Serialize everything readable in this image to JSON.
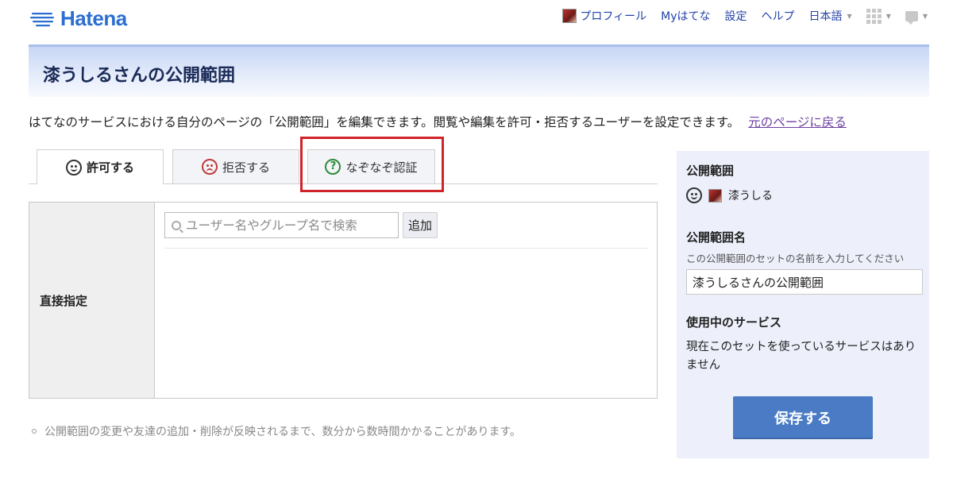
{
  "header": {
    "logo_text": "Hatena",
    "nav": {
      "profile": "プロフィール",
      "my": "Myはてな",
      "settings": "設定",
      "help": "ヘルプ",
      "language": "日本語"
    }
  },
  "page": {
    "title": "漆うしるさんの公開範囲",
    "description": "はてなのサービスにおける自分のページの「公開範囲」を編集できます。閲覧や編集を許可・拒否するユーザーを設定できます。",
    "back_link": "元のページに戻る"
  },
  "tabs": [
    {
      "label": "許可する",
      "icon": "smile-face-icon"
    },
    {
      "label": "拒否する",
      "icon": "angry-face-icon"
    },
    {
      "label": "なぞなぞ認証",
      "icon": "question-icon"
    }
  ],
  "direct": {
    "row_label": "直接指定",
    "search_placeholder": "ユーザー名やグループ名で検索",
    "add_label": "追加"
  },
  "note": "公開範囲の変更や友達の追加・削除が反映されるまで、数分から数時間かかることがあります。",
  "side": {
    "scope_heading": "公開範囲",
    "scope_user": "漆うしる",
    "name_heading": "公開範囲名",
    "name_hint": "この公開範囲のセットの名前を入力してください",
    "name_value": "漆うしるさんの公開範囲",
    "service_heading": "使用中のサービス",
    "service_text": "現在このセットを使っているサービスはありません",
    "save_label": "保存する"
  },
  "colors": {
    "link": "#2342a8",
    "save_button": "#4a7bc4",
    "highlight": "#d0242a"
  }
}
